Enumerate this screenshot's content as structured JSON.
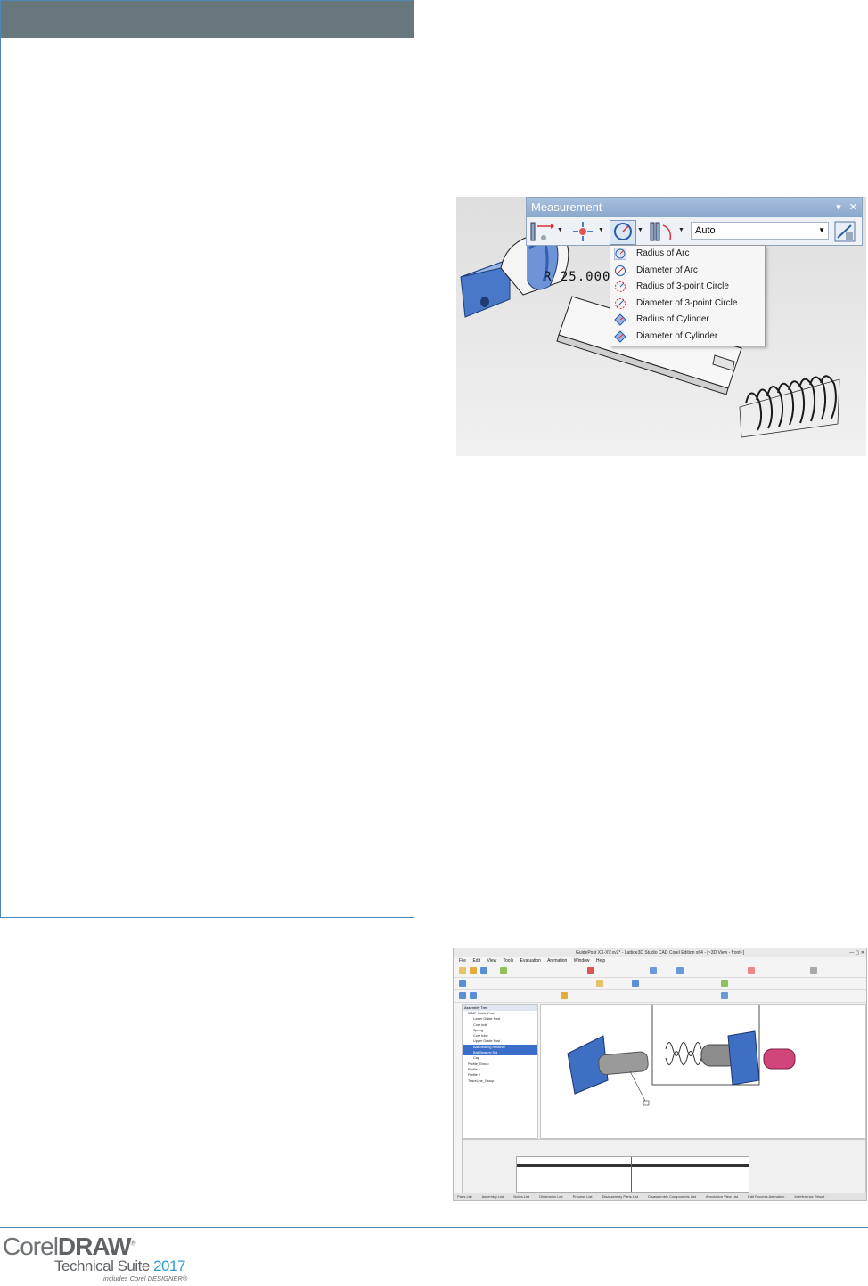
{
  "measurement_panel": {
    "title": "Measurement",
    "window_buttons": [
      "▾",
      "✕"
    ],
    "mode_value": "Auto",
    "dimension_label": "R 25.000",
    "menu_items": [
      {
        "label": "Radius of Arc",
        "icon": "radius-arc-icon"
      },
      {
        "label": "Diameter of Arc",
        "icon": "diameter-arc-icon"
      },
      {
        "label": "Radius of 3-point Circle",
        "icon": "radius-3pt-circle-icon"
      },
      {
        "label": "Diameter of 3-point Circle",
        "icon": "diameter-3pt-circle-icon"
      },
      {
        "label": "Radius of Cylinder",
        "icon": "radius-cylinder-icon"
      },
      {
        "label": "Diameter of Cylinder",
        "icon": "diameter-cylinder-icon"
      }
    ]
  },
  "app_window": {
    "title": "GuidePost XX-XV.xv2* - Lattice3D Studio CAD Corel Edition x64 - [~3D View - front~]",
    "menus": [
      "File",
      "Edit",
      "View",
      "Tools",
      "Evaluation",
      "Animation",
      "Window",
      "Help"
    ],
    "assembly_tree_title": "Assembly Tree",
    "tree_items": [
      {
        "label": "M36F Guide Post",
        "selected": false
      },
      {
        "label": "Lower Guide Post",
        "selected": false
      },
      {
        "label": "Core bolt",
        "selected": false
      },
      {
        "label": "Spring",
        "selected": false
      },
      {
        "label": "Core tube",
        "selected": false
      },
      {
        "label": "Upper Guide Post",
        "selected": false
      },
      {
        "label": "Ball Bearing Retainer",
        "selected": true
      },
      {
        "label": "Ball Bearing Std",
        "selected": true
      },
      {
        "label": "Cap",
        "selected": false
      },
      {
        "label": "Profile_Group",
        "selected": false
      },
      {
        "label": "Profile 1",
        "selected": false
      },
      {
        "label": "Profile 2",
        "selected": false
      },
      {
        "label": "TraceLine_Group",
        "selected": false
      }
    ],
    "status_tabs": [
      "Parts List",
      "Assembly List",
      "Notes List",
      "Dimension List",
      "Process List",
      "Disassembly Parts List",
      "Disassembly Components List",
      "Annotation View List",
      "Edit Process Animation",
      "Interference Result"
    ]
  },
  "footer": {
    "brand_light": "Corel",
    "brand_bold": "DRAW",
    "brand_mark": "®",
    "suite": "Technical Suite",
    "year": "2017",
    "includes": "includes Corel DESIGNER®"
  },
  "colors": {
    "accent_blue": "#4b88b8",
    "sidebar_header": "#67777c",
    "year_blue": "#2f9bd6"
  }
}
